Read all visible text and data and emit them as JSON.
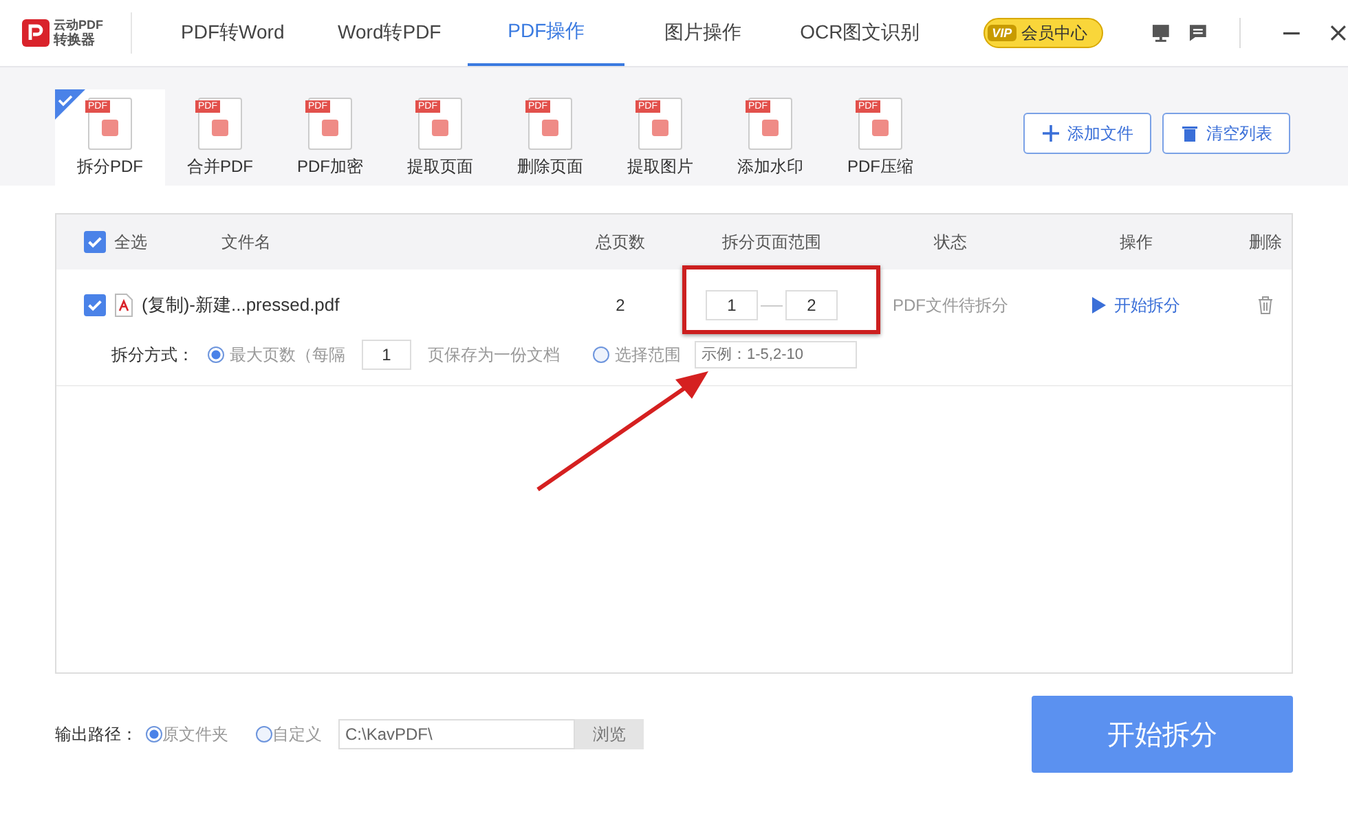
{
  "logo": {
    "line_1": "云动PDF",
    "line_2": "转换器"
  },
  "nav_tabs": [
    {
      "label": "PDF转Word",
      "selected": false
    },
    {
      "label": "Word转PDF",
      "selected": false
    },
    {
      "label": "PDF操作",
      "selected": true
    },
    {
      "label": "图片操作",
      "selected": false
    },
    {
      "label": "OCR图文识别",
      "selected": false
    }
  ],
  "vip": {
    "badge": "VIP",
    "label": "会员中心"
  },
  "tools": [
    {
      "label": "拆分PDF",
      "badge": "PDF",
      "selected": true
    },
    {
      "label": "合并PDF",
      "badge": "PDF",
      "selected": false
    },
    {
      "label": "PDF加密",
      "badge": "PDF",
      "selected": false
    },
    {
      "label": "提取页面",
      "badge": "PDF",
      "selected": false
    },
    {
      "label": "删除页面",
      "badge": "PDF",
      "selected": false
    },
    {
      "label": "提取图片",
      "badge": "PDF",
      "selected": false
    },
    {
      "label": "添加水印",
      "badge": "PDF",
      "selected": false
    },
    {
      "label": "PDF压缩",
      "badge": "PDF",
      "selected": false
    }
  ],
  "actions": [
    "添加文件",
    "清空列表"
  ],
  "table": {
    "select_all": {
      "label": "全选",
      "checked": true
    },
    "columns": [
      "文件名",
      "总页数",
      "拆分页面范围",
      "状态",
      "操作",
      "删除"
    ],
    "rows": [
      {
        "checked": true,
        "file": "(复制)-新建...pressed.pdf",
        "pages": "2",
        "range_from": "1",
        "range_to": "2",
        "status": "PDF文件待拆分",
        "action": "开始拆分",
        "split": {
          "label": "拆分方式：",
          "option_1": {
            "label": "最大页数（每隔",
            "selected": true
          },
          "every": "1",
          "every_suffix": "页保存为一份文档",
          "option_2": {
            "label": "选择范围",
            "selected": false
          },
          "range_placeholder": "示例：1-5,2-10"
        }
      }
    ]
  },
  "output": {
    "label": "输出路径：",
    "option_1": {
      "label": "原文件夹",
      "selected": true
    },
    "option_2": {
      "label": "自定义",
      "selected": false
    },
    "path": "C:\\KavPDF\\",
    "browse": "浏览"
  },
  "start_button": "开始拆分"
}
